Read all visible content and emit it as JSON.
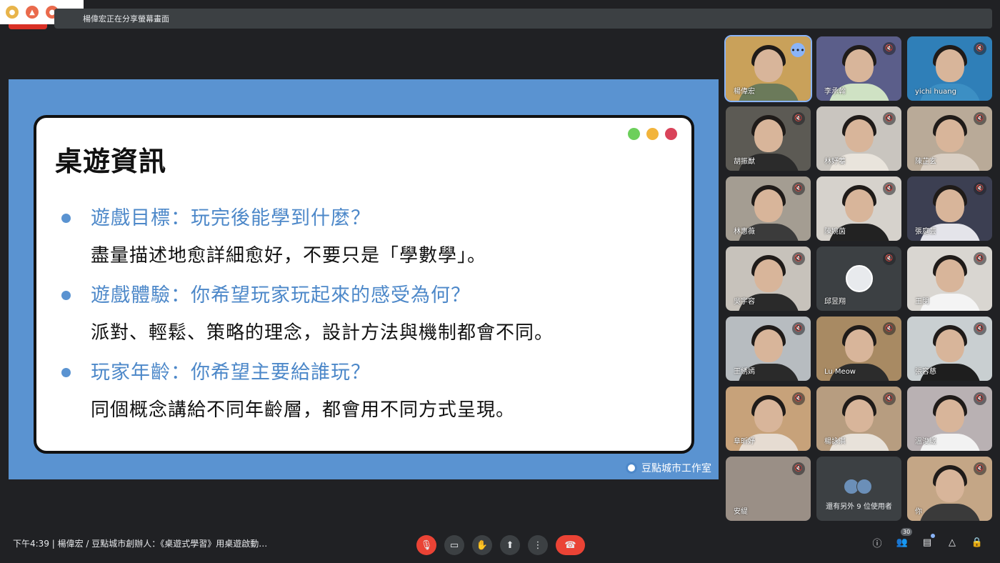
{
  "top": {
    "share_notice": "楊偉宏正在分享螢幕畫面"
  },
  "slide": {
    "title": "桌遊資訊",
    "items": [
      {
        "heading": "遊戲目標：玩完後能學到什麼？",
        "body": "盡量描述地愈詳細愈好，不要只是「學數學」。"
      },
      {
        "heading": "遊戲體驗：你希望玩家玩起來的感受為何？",
        "body": "派對、輕鬆、策略的理念，設計方法與機制都會不同。"
      },
      {
        "heading": "玩家年齡：你希望主要給誰玩？",
        "body": "同個概念講給不同年齡層，都會用不同方式呈現。"
      }
    ],
    "brand": "豆點城市工作室",
    "dot_colors": [
      "#6ccf5b",
      "#f2b43b",
      "#d9435a"
    ],
    "accent_color": "#5a93d1"
  },
  "participants": [
    {
      "name": "楊偉宏",
      "bg": "#c9a15a",
      "body": "#6b7a5a"
    },
    {
      "name": "李承翰",
      "bg": "#5b5e8a",
      "body": "#cfe2c4"
    },
    {
      "name": "yichi huang",
      "bg": "#2f7fb8",
      "body": "#3c8fc4"
    },
    {
      "name": "胡振猷",
      "bg": "#5c5a54",
      "body": "#2b2b2b"
    },
    {
      "name": "林妤蓁",
      "bg": "#c9c5bf",
      "body": "#e9e4dc"
    },
    {
      "name": "陳芷玄",
      "bg": "#b9aa98",
      "body": "#d9cfc4"
    },
    {
      "name": "林惠薇",
      "bg": "#a49d92",
      "body": "#3b3b3b"
    },
    {
      "name": "陳婉茵",
      "bg": "#d6d2cc",
      "body": "#222222"
    },
    {
      "name": "張庭芸",
      "bg": "#3c3f52",
      "body": "#e4e4ea"
    },
    {
      "name": "吳宇容",
      "bg": "#c7c2bb",
      "body": "#2a2a2a"
    },
    {
      "name": "邱昱翔",
      "avatar": true
    },
    {
      "name": "王閔",
      "bg": "#d9d6d1",
      "body": "#f4f4f4"
    },
    {
      "name": "王綉嫣",
      "bg": "#b7bcc0",
      "body": "#2a2a2a"
    },
    {
      "name": "Lu Meow",
      "bg": "#a88a63",
      "body": "#2c2c2c"
    },
    {
      "name": "張容慈",
      "bg": "#c9cfd1",
      "body": "#1e1e1e"
    },
    {
      "name": "阜昕妤",
      "bg": "#c7a27a",
      "body": "#e6dcd2"
    },
    {
      "name": "楊詠淇",
      "bg": "#b79d80",
      "body": "#e8e2da"
    },
    {
      "name": "溫浚崴",
      "bg": "#b9b1b3",
      "body": "#f2f2f2"
    },
    {
      "name": "安緹",
      "bg": "#9a8f86"
    },
    {
      "others": true,
      "text": "還有另外 9 位使用者"
    },
    {
      "name": "你",
      "bg": "#c4a686",
      "body": "#3a3a3a"
    }
  ],
  "bottom": {
    "meeting_info": "下午4:39  |  楊偉宏 / 豆點城市創辦人：《桌遊式學習》用桌遊啟動…",
    "participant_count": "30"
  },
  "icons": {
    "mic_off": "mic-off-icon",
    "camera": "camera-icon",
    "raise_hand": "raise-hand-icon",
    "present": "present-screen-icon",
    "more": "more-options-icon",
    "hangup": "hang-up-icon",
    "info": "info-icon",
    "people": "people-icon",
    "chat": "chat-icon",
    "activities": "activities-icon",
    "host_controls": "host-controls-icon"
  }
}
